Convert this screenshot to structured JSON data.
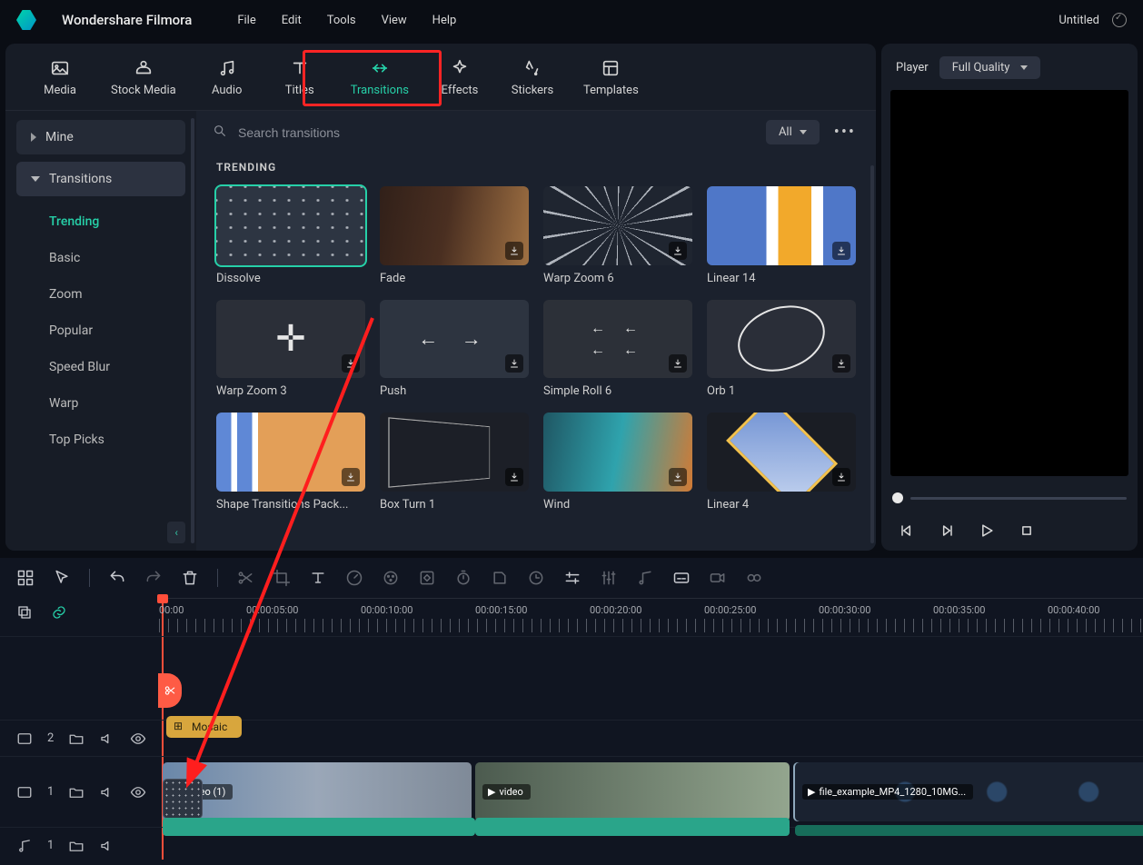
{
  "app": {
    "name": "Wondershare Filmora"
  },
  "menu": [
    "File",
    "Edit",
    "Tools",
    "View",
    "Help"
  ],
  "project": {
    "title": "Untitled"
  },
  "tabs": [
    {
      "id": "media",
      "label": "Media"
    },
    {
      "id": "stock",
      "label": "Stock Media"
    },
    {
      "id": "audio",
      "label": "Audio"
    },
    {
      "id": "titles",
      "label": "Titles"
    },
    {
      "id": "transitions",
      "label": "Transitions"
    },
    {
      "id": "effects",
      "label": "Effects"
    },
    {
      "id": "stickers",
      "label": "Stickers"
    },
    {
      "id": "templates",
      "label": "Templates"
    }
  ],
  "sidebar": {
    "parents": [
      {
        "label": "Mine"
      },
      {
        "label": "Transitions"
      }
    ],
    "items": [
      {
        "label": "Trending"
      },
      {
        "label": "Basic"
      },
      {
        "label": "Zoom"
      },
      {
        "label": "Popular"
      },
      {
        "label": "Speed Blur"
      },
      {
        "label": "Warp"
      },
      {
        "label": "Top Picks"
      }
    ]
  },
  "search": {
    "placeholder": "Search transitions",
    "filter": "All"
  },
  "section_title": "TRENDING",
  "transitions": [
    {
      "name": "Dissolve",
      "cls": "dissolve",
      "selected": true,
      "dl": false
    },
    {
      "name": "Fade",
      "cls": "fade",
      "dl": true
    },
    {
      "name": "Warp Zoom 6",
      "cls": "warp",
      "dl": true
    },
    {
      "name": "Linear 14",
      "cls": "linear14",
      "dl": true
    },
    {
      "name": "Warp Zoom 3",
      "cls": "warpz3",
      "dl": true
    },
    {
      "name": "Push",
      "cls": "push",
      "dl": true
    },
    {
      "name": "Simple Roll 6",
      "cls": "roll",
      "dl": true
    },
    {
      "name": "Orb 1",
      "cls": "orb",
      "dl": true
    },
    {
      "name": "Shape Transitions Pack...",
      "cls": "shape",
      "dl": true
    },
    {
      "name": "Box Turn 1",
      "cls": "box",
      "dl": true
    },
    {
      "name": "Wind",
      "cls": "wind",
      "dl": true
    },
    {
      "name": "Linear 4",
      "cls": "linear4",
      "dl": true
    }
  ],
  "player": {
    "label": "Player",
    "quality": "Full Quality"
  },
  "timeline": {
    "times": [
      "00:00",
      "00:00:05:00",
      "00:00:10:00",
      "00:00:15:00",
      "00:00:20:00",
      "00:00:25:00",
      "00:00:30:00",
      "00:00:35:00",
      "00:00:40:00"
    ],
    "tracks": {
      "img": {
        "label": "2"
      },
      "vid": {
        "label": "1"
      },
      "aud": {
        "label": "1"
      }
    },
    "mosaic_tag": "Mosaic",
    "clips": {
      "video_chip": "video",
      "video2_chip": "video (1)",
      "file_chip": "file_example_MP4_1280_10MG..."
    }
  }
}
